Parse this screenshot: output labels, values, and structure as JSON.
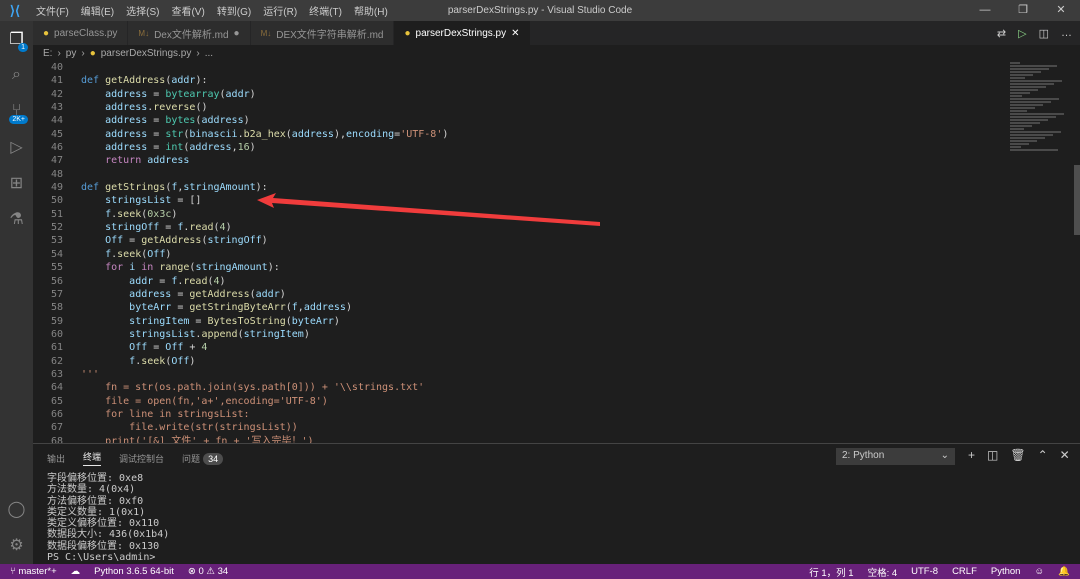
{
  "window": {
    "title": "parserDexStrings.py - Visual Studio Code",
    "menu": [
      "文件(F)",
      "编辑(E)",
      "选择(S)",
      "查看(V)",
      "转到(G)",
      "运行(R)",
      "终端(T)",
      "帮助(H)"
    ]
  },
  "activity": {
    "explorer_badge": "1",
    "scm_badge": "2K+"
  },
  "tabs": [
    {
      "label": "parseClass.py",
      "icon": "python"
    },
    {
      "label": "Dex文件解析.md",
      "icon": "markdown",
      "modified": true
    },
    {
      "label": "DEX文件字符串解析.md",
      "icon": "markdown"
    },
    {
      "label": "parserDexStrings.py",
      "icon": "python",
      "active": true
    }
  ],
  "breadcrumb": [
    "E:",
    "py",
    "parserDexStrings.py",
    "..."
  ],
  "editor": {
    "lines": [
      {
        "n": "40",
        "t": []
      },
      {
        "n": "41",
        "t": [
          [
            "kw",
            "def "
          ],
          [
            "fn",
            "getAddress"
          ],
          [
            "pl",
            "("
          ],
          [
            "var",
            "addr"
          ],
          [
            "pl",
            "):"
          ]
        ]
      },
      {
        "n": "42",
        "t": [
          [
            "pl",
            "    "
          ],
          [
            "var",
            "address"
          ],
          [
            "pl",
            " = "
          ],
          [
            "bi",
            "bytearray"
          ],
          [
            "pl",
            "("
          ],
          [
            "var",
            "addr"
          ],
          [
            "pl",
            ")"
          ]
        ]
      },
      {
        "n": "43",
        "t": [
          [
            "pl",
            "    "
          ],
          [
            "var",
            "address"
          ],
          [
            "pl",
            "."
          ],
          [
            "fn",
            "reverse"
          ],
          [
            "pl",
            "()"
          ]
        ]
      },
      {
        "n": "44",
        "t": [
          [
            "pl",
            "    "
          ],
          [
            "var",
            "address"
          ],
          [
            "pl",
            " = "
          ],
          [
            "bi",
            "bytes"
          ],
          [
            "pl",
            "("
          ],
          [
            "var",
            "address"
          ],
          [
            "pl",
            ")"
          ]
        ]
      },
      {
        "n": "45",
        "t": [
          [
            "pl",
            "    "
          ],
          [
            "var",
            "address"
          ],
          [
            "pl",
            " = "
          ],
          [
            "bi",
            "str"
          ],
          [
            "pl",
            "("
          ],
          [
            "var",
            "binascii"
          ],
          [
            "pl",
            "."
          ],
          [
            "fn",
            "b2a_hex"
          ],
          [
            "pl",
            "("
          ],
          [
            "var",
            "address"
          ],
          [
            "pl",
            "),"
          ],
          [
            "var",
            "encoding"
          ],
          [
            "pl",
            "="
          ],
          [
            "str",
            "'UTF-8'"
          ],
          [
            "pl",
            ")"
          ]
        ]
      },
      {
        "n": "46",
        "t": [
          [
            "pl",
            "    "
          ],
          [
            "var",
            "address"
          ],
          [
            "pl",
            " = "
          ],
          [
            "bi",
            "int"
          ],
          [
            "pl",
            "("
          ],
          [
            "var",
            "address"
          ],
          [
            "pl",
            ","
          ],
          [
            "num",
            "16"
          ],
          [
            "pl",
            ")"
          ]
        ]
      },
      {
        "n": "47",
        "t": [
          [
            "pl",
            "    "
          ],
          [
            "ctl",
            "return "
          ],
          [
            "var",
            "address"
          ]
        ]
      },
      {
        "n": "48",
        "t": []
      },
      {
        "n": "49",
        "t": [
          [
            "kw",
            "def "
          ],
          [
            "fn",
            "getStrings"
          ],
          [
            "pl",
            "("
          ],
          [
            "var",
            "f"
          ],
          [
            "pl",
            ","
          ],
          [
            "var",
            "stringAmount"
          ],
          [
            "pl",
            "):"
          ]
        ]
      },
      {
        "n": "50",
        "t": [
          [
            "pl",
            "    "
          ],
          [
            "var",
            "stringsList"
          ],
          [
            "pl",
            " = []"
          ]
        ]
      },
      {
        "n": "51",
        "t": [
          [
            "pl",
            "    "
          ],
          [
            "var",
            "f"
          ],
          [
            "pl",
            "."
          ],
          [
            "fn",
            "seek"
          ],
          [
            "pl",
            "("
          ],
          [
            "num",
            "0x3c"
          ],
          [
            "pl",
            ")"
          ]
        ]
      },
      {
        "n": "52",
        "t": [
          [
            "pl",
            "    "
          ],
          [
            "var",
            "stringOff"
          ],
          [
            "pl",
            " = "
          ],
          [
            "var",
            "f"
          ],
          [
            "pl",
            "."
          ],
          [
            "fn",
            "read"
          ],
          [
            "pl",
            "("
          ],
          [
            "num",
            "4"
          ],
          [
            "pl",
            ")"
          ]
        ]
      },
      {
        "n": "53",
        "t": [
          [
            "pl",
            "    "
          ],
          [
            "var",
            "Off"
          ],
          [
            "pl",
            " = "
          ],
          [
            "fn",
            "getAddress"
          ],
          [
            "pl",
            "("
          ],
          [
            "var",
            "stringOff"
          ],
          [
            "pl",
            ")"
          ]
        ]
      },
      {
        "n": "54",
        "t": [
          [
            "pl",
            "    "
          ],
          [
            "var",
            "f"
          ],
          [
            "pl",
            "."
          ],
          [
            "fn",
            "seek"
          ],
          [
            "pl",
            "("
          ],
          [
            "var",
            "Off"
          ],
          [
            "pl",
            ")"
          ]
        ]
      },
      {
        "n": "55",
        "t": [
          [
            "pl",
            "    "
          ],
          [
            "ctl",
            "for "
          ],
          [
            "var",
            "i"
          ],
          [
            "ctl",
            " in "
          ],
          [
            "fn",
            "range"
          ],
          [
            "pl",
            "("
          ],
          [
            "var",
            "stringAmount"
          ],
          [
            "pl",
            "):"
          ]
        ]
      },
      {
        "n": "56",
        "t": [
          [
            "pl",
            "        "
          ],
          [
            "var",
            "addr"
          ],
          [
            "pl",
            " = "
          ],
          [
            "var",
            "f"
          ],
          [
            "pl",
            "."
          ],
          [
            "fn",
            "read"
          ],
          [
            "pl",
            "("
          ],
          [
            "num",
            "4"
          ],
          [
            "pl",
            ")"
          ]
        ]
      },
      {
        "n": "57",
        "t": [
          [
            "pl",
            "        "
          ],
          [
            "var",
            "address"
          ],
          [
            "pl",
            " = "
          ],
          [
            "fn",
            "getAddress"
          ],
          [
            "pl",
            "("
          ],
          [
            "var",
            "addr"
          ],
          [
            "pl",
            ")"
          ]
        ]
      },
      {
        "n": "58",
        "t": [
          [
            "pl",
            "        "
          ],
          [
            "var",
            "byteArr"
          ],
          [
            "pl",
            " = "
          ],
          [
            "fn",
            "getStringByteArr"
          ],
          [
            "pl",
            "("
          ],
          [
            "var",
            "f"
          ],
          [
            "pl",
            ","
          ],
          [
            "var",
            "address"
          ],
          [
            "pl",
            ")"
          ]
        ]
      },
      {
        "n": "59",
        "t": [
          [
            "pl",
            "        "
          ],
          [
            "var",
            "stringItem"
          ],
          [
            "pl",
            " = "
          ],
          [
            "fn",
            "BytesToString"
          ],
          [
            "pl",
            "("
          ],
          [
            "var",
            "byteArr"
          ],
          [
            "pl",
            ")"
          ]
        ]
      },
      {
        "n": "60",
        "t": [
          [
            "pl",
            "        "
          ],
          [
            "var",
            "stringsList"
          ],
          [
            "pl",
            "."
          ],
          [
            "fn",
            "append"
          ],
          [
            "pl",
            "("
          ],
          [
            "var",
            "stringItem"
          ],
          [
            "pl",
            ")"
          ]
        ]
      },
      {
        "n": "61",
        "t": [
          [
            "pl",
            "        "
          ],
          [
            "var",
            "Off"
          ],
          [
            "pl",
            " = "
          ],
          [
            "var",
            "Off"
          ],
          [
            "pl",
            " + "
          ],
          [
            "num",
            "4"
          ]
        ]
      },
      {
        "n": "62",
        "t": [
          [
            "pl",
            "        "
          ],
          [
            "var",
            "f"
          ],
          [
            "pl",
            "."
          ],
          [
            "fn",
            "seek"
          ],
          [
            "pl",
            "("
          ],
          [
            "var",
            "Off"
          ],
          [
            "pl",
            ")"
          ]
        ]
      },
      {
        "n": "63",
        "t": [
          [
            "str",
            "'''"
          ]
        ]
      },
      {
        "n": "64",
        "t": [
          [
            "str",
            "    fn = str(os.path.join(sys.path[0])) + '\\\\strings.txt'"
          ]
        ]
      },
      {
        "n": "65",
        "t": [
          [
            "str",
            "    file = open(fn,'a+',encoding='UTF-8')"
          ]
        ]
      },
      {
        "n": "66",
        "t": [
          [
            "str",
            "    for line in stringsList:"
          ]
        ]
      },
      {
        "n": "67",
        "t": [
          [
            "str",
            "        file.write(str(stringsList))"
          ]
        ]
      },
      {
        "n": "68",
        "t": [
          [
            "str",
            "    print('[&] 文件' + fn + '写入完毕！')"
          ]
        ]
      }
    ]
  },
  "panel": {
    "tabs": [
      "输出",
      "终端",
      "调试控制台",
      "问题"
    ],
    "active": "终端",
    "problems_count": "34",
    "terminal_select": "2: Python",
    "terminal_lines": [
      "字段偏移位置: 0xe8",
      "方法数量: 4(0x4)",
      "方法偏移位置: 0xf0",
      "类定义数量: 1(0x1)",
      "类定义偏移位置: 0x110",
      "数据段大小: 436(0x1b4)",
      "数据段偏移位置: 0x130",
      "PS C:\\Users\\admin>"
    ]
  },
  "status": {
    "branch": "master*+",
    "python": "Python 3.6.5 64-bit",
    "errors": "0",
    "warnings": "34",
    "position": "行 1，列 1",
    "spaces": "空格: 4",
    "encoding": "UTF-8",
    "eol": "CRLF",
    "language": "Python",
    "color": "#68217a"
  },
  "annotation": {
    "arrow_color": "#f03c3c"
  }
}
